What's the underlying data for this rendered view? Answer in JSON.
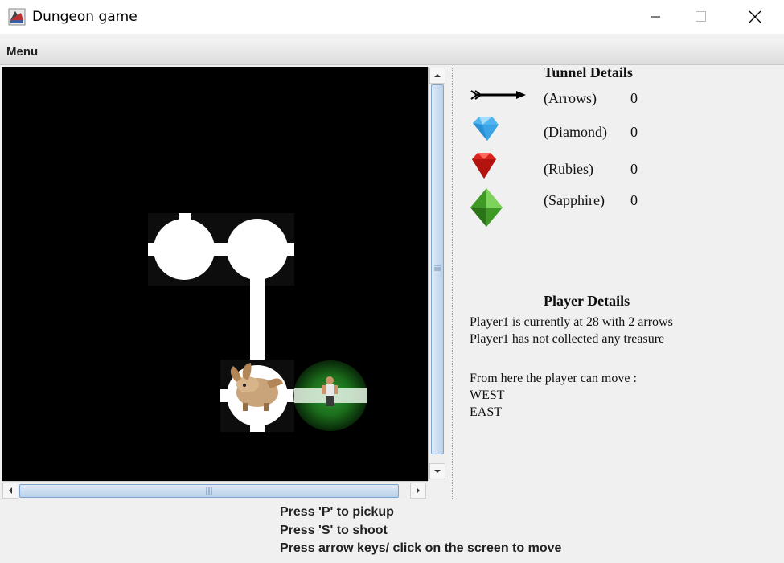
{
  "window": {
    "title": "Dungeon game",
    "icon": "app-icon"
  },
  "menubar": {
    "menu_label": "Menu"
  },
  "game": {
    "vertical_scroll": {
      "position_fraction": 0.0,
      "visible_fraction": 0.95
    },
    "horizontal_scroll": {
      "position_fraction": 0.0,
      "visible_fraction": 0.97
    }
  },
  "tunnel_details": {
    "title": "Tunnel Details",
    "items": [
      {
        "icon": "arrow-icon",
        "label": "(Arrows)",
        "value": "0"
      },
      {
        "icon": "diamond-icon",
        "label": "(Diamond)",
        "value": "0"
      },
      {
        "icon": "ruby-icon",
        "label": "(Rubies)",
        "value": "0"
      },
      {
        "icon": "sapphire-icon",
        "label": "(Sapphire)",
        "value": "0"
      }
    ]
  },
  "player_details": {
    "title": "Player Details",
    "lines": [
      "Player1 is currently at 28 with 2 arrows",
      "Player1 has not collected any treasure",
      "From here the player can move :",
      "WEST",
      "EAST"
    ]
  },
  "instructions": [
    "Press 'P' to pickup",
    "Press 'S' to shoot",
    "Press arrow keys/ click on the screen to move"
  ],
  "colors": {
    "canvas_bg": "#000000",
    "tunnel": "#ffffff",
    "smell_glow": "#1f8a1f"
  }
}
